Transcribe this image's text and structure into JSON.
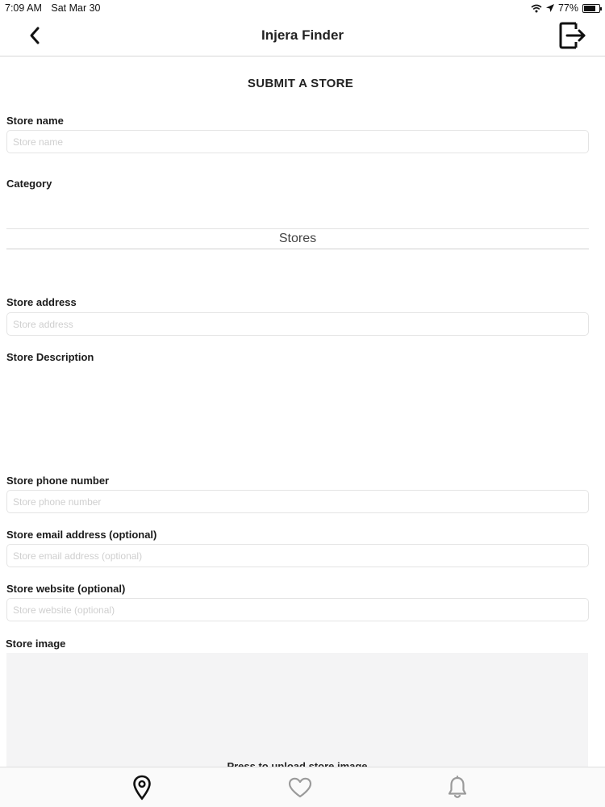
{
  "status_bar": {
    "time": "7:09 AM",
    "date": "Sat Mar 30",
    "battery": "77%"
  },
  "nav": {
    "title": "Injera Finder",
    "back_icon": "chevron-left-icon",
    "logout_icon": "logout-icon"
  },
  "form": {
    "heading": "SUBMIT A STORE",
    "store_name": {
      "label": "Store name",
      "placeholder": "Store name"
    },
    "category": {
      "label": "Category",
      "selected": "Stores"
    },
    "store_address": {
      "label": "Store address",
      "placeholder": "Store address"
    },
    "description": {
      "label": "Store Description"
    },
    "phone": {
      "label": "Store phone number",
      "placeholder": "Store phone number"
    },
    "email": {
      "label": "Store email address (optional)",
      "placeholder": "Store email address (optional)"
    },
    "website": {
      "label": "Store website (optional)",
      "placeholder": "Store website (optional)"
    },
    "image": {
      "label": "Store image",
      "hint": "Press to upload store image"
    }
  },
  "tab_bar": {
    "tabs": [
      {
        "icon": "map-pin-icon",
        "active": true
      },
      {
        "icon": "heart-icon",
        "active": false
      },
      {
        "icon": "bell-icon",
        "active": false
      }
    ]
  }
}
